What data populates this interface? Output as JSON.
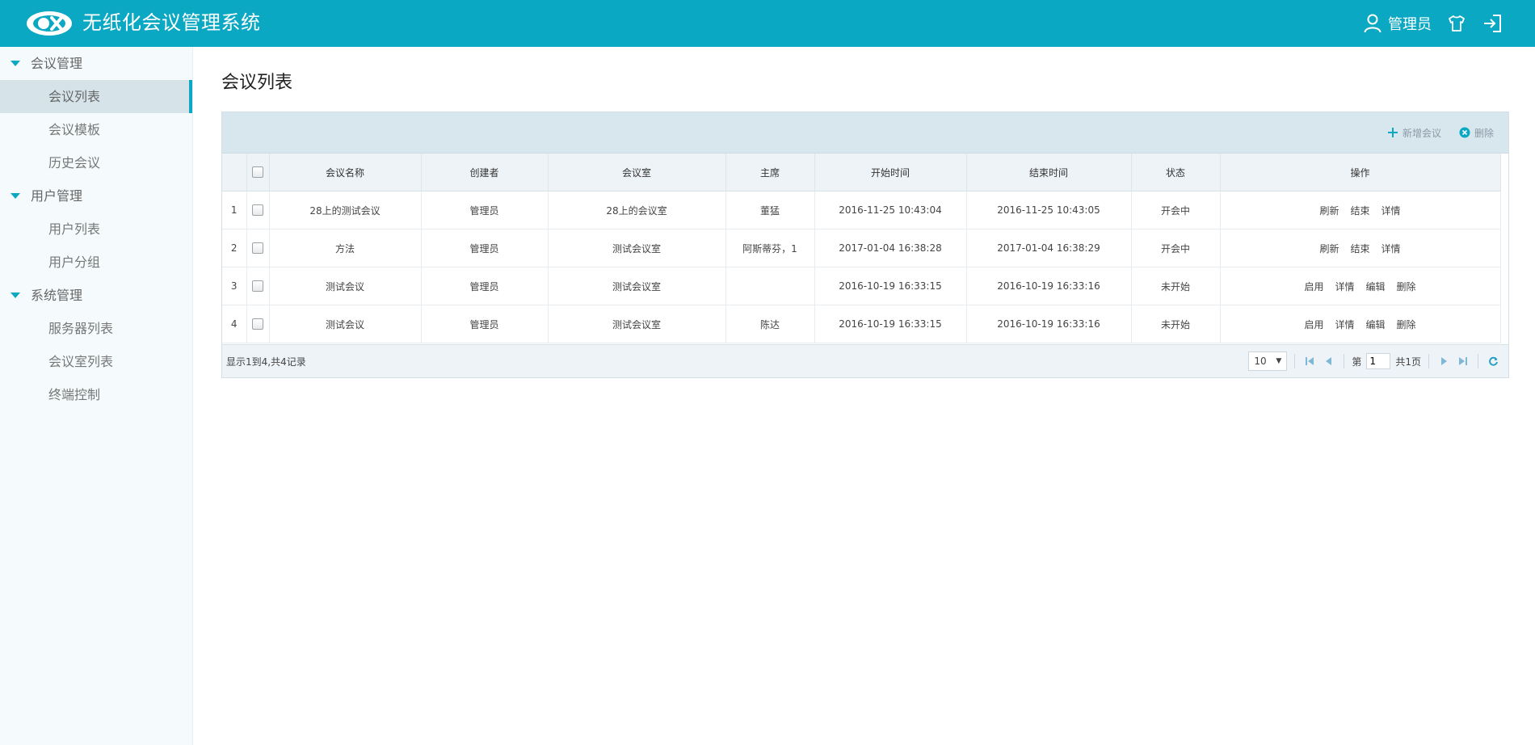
{
  "header": {
    "title": "无纸化会议管理系统",
    "user": "管理员",
    "colors": {
      "brand": "#0aa8c2"
    },
    "icons": [
      "logo-icon",
      "user-icon",
      "shirt-icon",
      "logout-icon"
    ]
  },
  "sidebar": {
    "groups": [
      {
        "title": "会议管理",
        "items": [
          "会议列表",
          "会议模板",
          "历史会议"
        ]
      },
      {
        "title": "用户管理",
        "items": [
          "用户列表",
          "用户分组"
        ]
      },
      {
        "title": "系统管理",
        "items": [
          "服务器列表",
          "会议室列表",
          "终端控制"
        ]
      }
    ],
    "active": "会议列表"
  },
  "main": {
    "page_title": "会议列表",
    "toolbar": {
      "add_label": "新增会议",
      "delete_label": "删除"
    },
    "table": {
      "columns": [
        "会议名称",
        "创建者",
        "会议室",
        "主席",
        "开始时间",
        "结束时间",
        "状态",
        "操作"
      ],
      "rows": [
        {
          "num": "1",
          "name": "28上的测试会议",
          "creator": "管理员",
          "room": "28上的会议室",
          "chair": "董猛",
          "start": "2016-11-25 10:43:04",
          "end": "2016-11-25 10:43:05",
          "status": "开会中",
          "ops": [
            "刷新",
            "结束",
            "详情"
          ]
        },
        {
          "num": "2",
          "name": "方法",
          "creator": "管理员",
          "room": "测试会议室",
          "chair": "阿斯蒂芬，1",
          "start": "2017-01-04 16:38:28",
          "end": "2017-01-04 16:38:29",
          "status": "开会中",
          "ops": [
            "刷新",
            "结束",
            "详情"
          ]
        },
        {
          "num": "3",
          "name": "测试会议",
          "creator": "管理员",
          "room": "测试会议室",
          "chair": "",
          "start": "2016-10-19 16:33:15",
          "end": "2016-10-19 16:33:16",
          "status": "未开始",
          "ops": [
            "启用",
            "详情",
            "编辑",
            "删除"
          ]
        },
        {
          "num": "4",
          "name": "测试会议",
          "creator": "管理员",
          "room": "测试会议室",
          "chair": "陈达",
          "start": "2016-10-19 16:33:15",
          "end": "2016-10-19 16:33:16",
          "status": "未开始",
          "ops": [
            "启用",
            "详情",
            "编辑",
            "删除"
          ]
        }
      ],
      "status_colors": {
        "开会中": "#1a8a1a",
        "未开始": "#1b2fd6"
      }
    },
    "footer": {
      "info": "显示1到4,共4记录",
      "page_size": "10",
      "page_prefix": "第",
      "page_value": "1",
      "page_total": "共1页"
    }
  }
}
